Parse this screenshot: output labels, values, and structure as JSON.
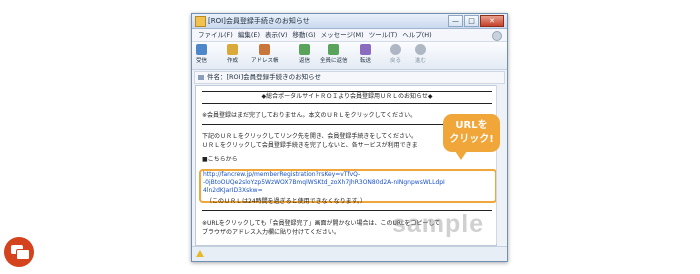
{
  "window": {
    "title": "[ROI]会員登録手続きのお知らせ",
    "controls": [
      "—",
      "□",
      "✕"
    ]
  },
  "menu": [
    "ファイル(F)",
    "編集(E)",
    "表示(V)",
    "移動(G)",
    "メッセージ(M)",
    "ツール(T)",
    "ヘルプ(H)"
  ],
  "toolbar": {
    "receive": "受信",
    "compose": "作成",
    "addressbook": "アドレス帳",
    "reply": "返信",
    "reply_all": "全員に返信",
    "forward": "転送",
    "back": "戻る",
    "next": "進む"
  },
  "subject": {
    "label": "件名：[ROI]会員登録手続きのお知らせ"
  },
  "body": {
    "heading": "◆総合ポータルサイトＲＯＩより会員登録用ＵＲＬのお知らせ◆",
    "note1": "※会員登録はまだ完了しておりません。本文のＵＲＬをクリックしてください。",
    "para1_line1": "下記のＵＲＬをクリックしてリンク先を開き、会員登録手続きをしてください。",
    "para1_line2": "ＵＲＬをクリックして会員登録手続きを完了しないと、各サービスが利用できま",
    "section_label": "■こちらから",
    "url_line1": "http://fancrew.jp/memberRegistration?rsKey=vTfvQ-",
    "url_line2": "-0jBtoOUQe2sloYzp5WzWOX7BmqlWSKtd_zoXh7JhR3ON80d2A-nINgnpwsWLLdpI",
    "url_line3": "4ln2dKJarID3Xskw=",
    "expiry": "（このＵＲＬは24時間を過ぎると使用できなくなります。）",
    "note2_line1": "※URLをクリックしても「会員登録完了」画面が開かない場合は、このURLをコピーして",
    "note2_line2": "ブラウザのアドレス入力欄に貼り付けてください。"
  },
  "callout": {
    "line1": "URLを",
    "line2": "クリック!"
  },
  "watermark": "sample",
  "colors": {
    "callout": "#f0a638",
    "link": "#1a52c7",
    "chat_button": "#d4431e"
  }
}
